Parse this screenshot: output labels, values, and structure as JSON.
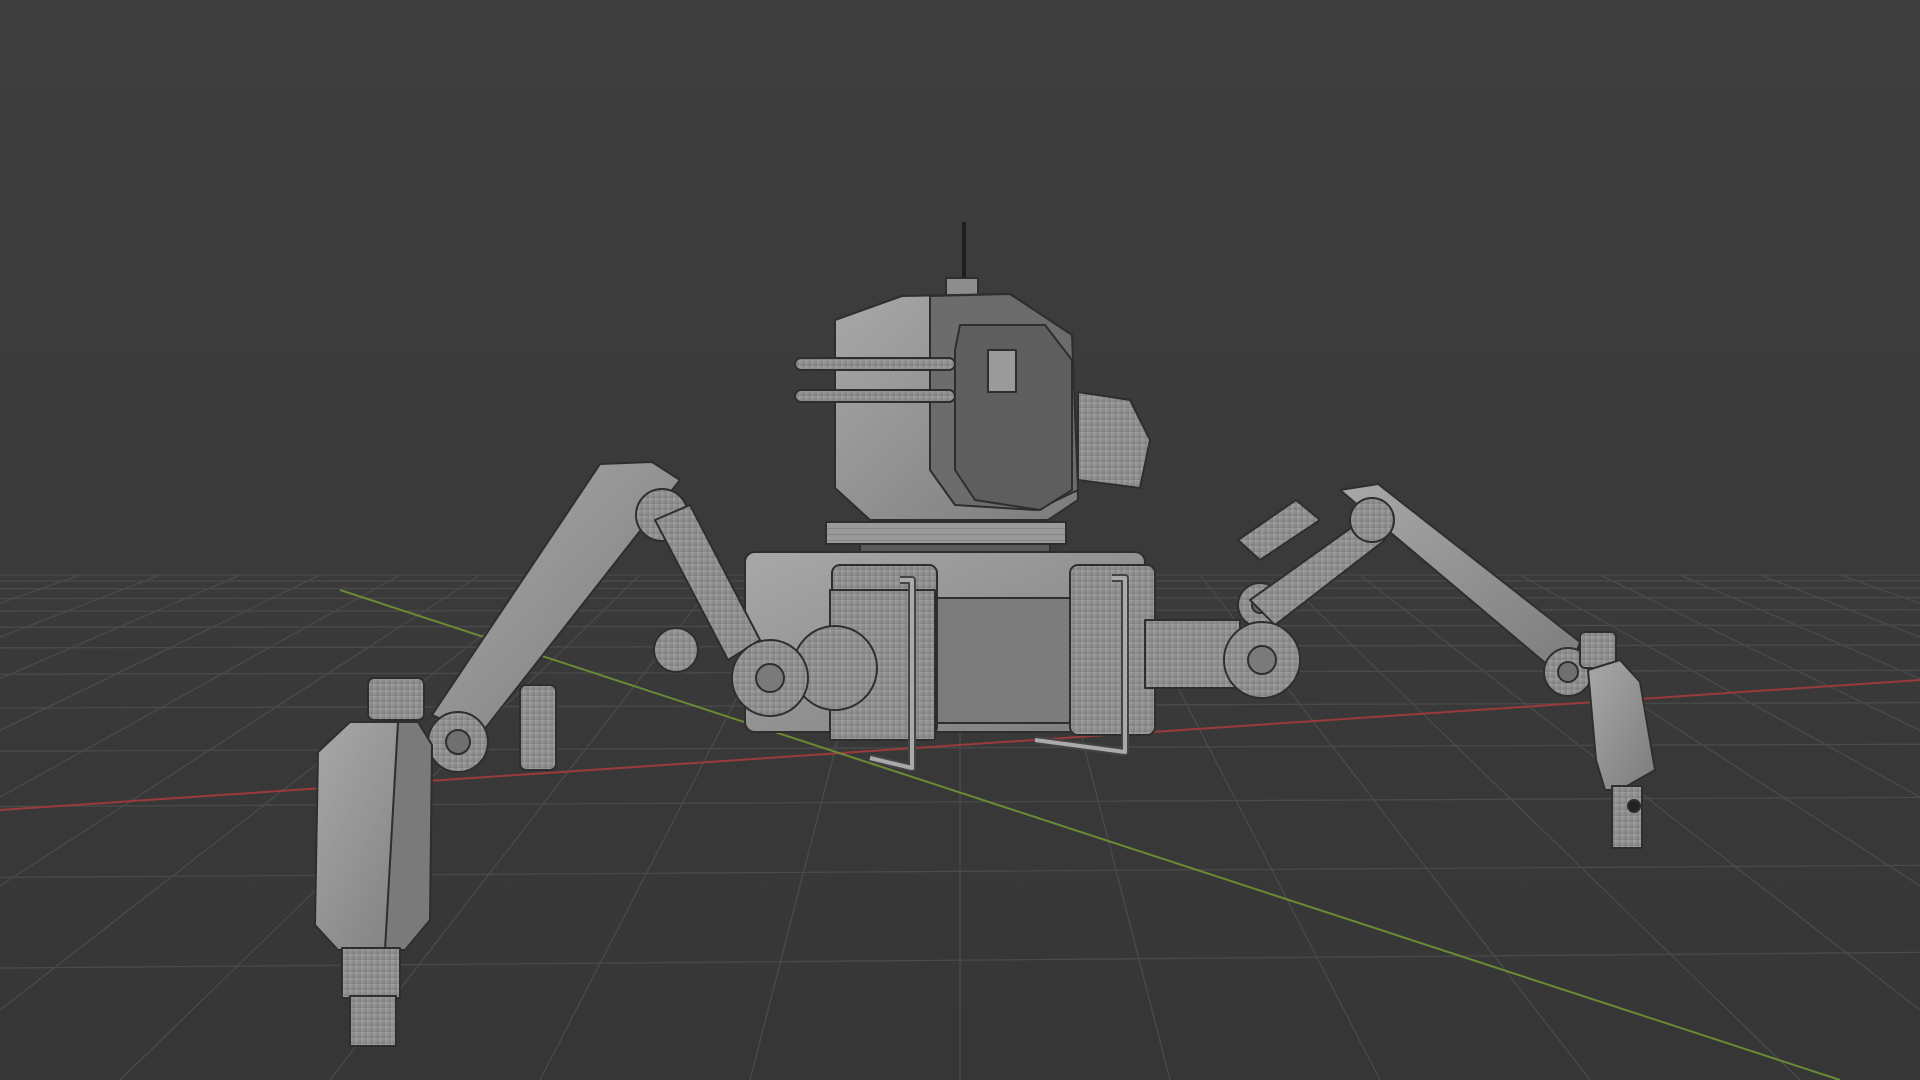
{
  "viewport": {
    "mode": "wireframe-overlay",
    "background_color": "#3c3c3c",
    "grid_color": "#4a4a4a",
    "x_axis_color": "#9a3a3a",
    "y_axis_color": "#6a8a36",
    "model_color": "#8a8a8a"
  },
  "model": {
    "name_icon": "robot-spider-model",
    "parts": [
      "antenna",
      "head",
      "body",
      "leg-front-left",
      "leg-front-right",
      "leg-back-left"
    ]
  }
}
